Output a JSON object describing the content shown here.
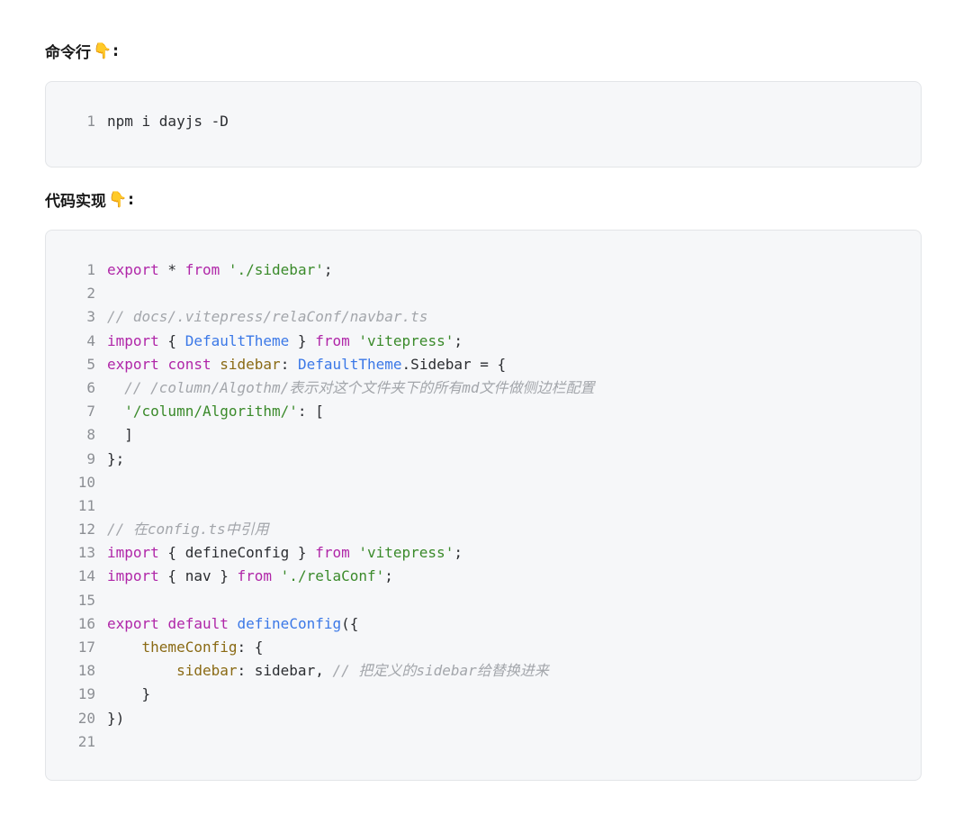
{
  "section1": {
    "title": "命令行",
    "hand_icon": "👇",
    "colon": ":",
    "lines": [
      {
        "n": "1",
        "tokens": [
          {
            "t": "npm i dayjs -D",
            "c": ""
          }
        ]
      }
    ]
  },
  "section2": {
    "title": "代码实现",
    "hand_icon": "👇",
    "colon": ":",
    "lines": [
      {
        "n": "1",
        "tokens": [
          {
            "t": "export",
            "c": "kw"
          },
          {
            "t": " * ",
            "c": ""
          },
          {
            "t": "from",
            "c": "kw"
          },
          {
            "t": " ",
            "c": ""
          },
          {
            "t": "'./sidebar'",
            "c": "str"
          },
          {
            "t": ";",
            "c": ""
          }
        ]
      },
      {
        "n": "2",
        "tokens": []
      },
      {
        "n": "3",
        "tokens": [
          {
            "t": "// docs/.vitepress/relaConf/navbar.ts",
            "c": "cmt"
          }
        ]
      },
      {
        "n": "4",
        "tokens": [
          {
            "t": "import",
            "c": "kw"
          },
          {
            "t": " { ",
            "c": ""
          },
          {
            "t": "DefaultTheme",
            "c": "cls"
          },
          {
            "t": " } ",
            "c": ""
          },
          {
            "t": "from",
            "c": "kw"
          },
          {
            "t": " ",
            "c": ""
          },
          {
            "t": "'vitepress'",
            "c": "str"
          },
          {
            "t": ";",
            "c": ""
          }
        ]
      },
      {
        "n": "5",
        "tokens": [
          {
            "t": "export",
            "c": "kw"
          },
          {
            "t": " ",
            "c": ""
          },
          {
            "t": "const",
            "c": "kw"
          },
          {
            "t": " ",
            "c": ""
          },
          {
            "t": "sidebar",
            "c": "prop"
          },
          {
            "t": ": ",
            "c": ""
          },
          {
            "t": "DefaultTheme",
            "c": "cls"
          },
          {
            "t": ".Sidebar = {",
            "c": ""
          }
        ]
      },
      {
        "n": "6",
        "tokens": [
          {
            "t": "  ",
            "c": ""
          },
          {
            "t": "// /column/Algothm/表示对这个文件夹下的所有md文件做侧边栏配置",
            "c": "cmt"
          }
        ]
      },
      {
        "n": "7",
        "tokens": [
          {
            "t": "  ",
            "c": ""
          },
          {
            "t": "'/column/Algorithm/'",
            "c": "str"
          },
          {
            "t": ": [",
            "c": ""
          }
        ]
      },
      {
        "n": "8",
        "tokens": [
          {
            "t": "  ]",
            "c": ""
          }
        ]
      },
      {
        "n": "9",
        "tokens": [
          {
            "t": "};",
            "c": ""
          }
        ]
      },
      {
        "n": "10",
        "tokens": []
      },
      {
        "n": "11",
        "tokens": []
      },
      {
        "n": "12",
        "tokens": [
          {
            "t": "// 在config.ts中引用",
            "c": "cmt"
          }
        ]
      },
      {
        "n": "13",
        "tokens": [
          {
            "t": "import",
            "c": "kw"
          },
          {
            "t": " { defineConfig } ",
            "c": ""
          },
          {
            "t": "from",
            "c": "kw"
          },
          {
            "t": " ",
            "c": ""
          },
          {
            "t": "'vitepress'",
            "c": "str"
          },
          {
            "t": ";",
            "c": ""
          }
        ]
      },
      {
        "n": "14",
        "tokens": [
          {
            "t": "import",
            "c": "kw"
          },
          {
            "t": " { nav } ",
            "c": ""
          },
          {
            "t": "from",
            "c": "kw"
          },
          {
            "t": " ",
            "c": ""
          },
          {
            "t": "'./relaConf'",
            "c": "str"
          },
          {
            "t": ";",
            "c": ""
          }
        ]
      },
      {
        "n": "15",
        "tokens": []
      },
      {
        "n": "16",
        "tokens": [
          {
            "t": "export",
            "c": "kw"
          },
          {
            "t": " ",
            "c": ""
          },
          {
            "t": "default",
            "c": "kw"
          },
          {
            "t": " ",
            "c": ""
          },
          {
            "t": "defineConfig",
            "c": "cls"
          },
          {
            "t": "({",
            "c": ""
          }
        ]
      },
      {
        "n": "17",
        "tokens": [
          {
            "t": "    ",
            "c": ""
          },
          {
            "t": "themeConfig",
            "c": "prop"
          },
          {
            "t": ": {",
            "c": ""
          }
        ]
      },
      {
        "n": "18",
        "tokens": [
          {
            "t": "        ",
            "c": ""
          },
          {
            "t": "sidebar",
            "c": "prop"
          },
          {
            "t": ": sidebar, ",
            "c": ""
          },
          {
            "t": "// 把定义的sidebar给替换进来",
            "c": "cmt"
          }
        ]
      },
      {
        "n": "19",
        "tokens": [
          {
            "t": "    }",
            "c": ""
          }
        ]
      },
      {
        "n": "20",
        "tokens": [
          {
            "t": "})",
            "c": ""
          }
        ]
      },
      {
        "n": "21",
        "tokens": []
      }
    ]
  },
  "colors": {
    "keyword": "#b026a8",
    "string": "#3a8a2a",
    "type": "#3b78e7",
    "property": "#8a6a14",
    "comment": "#a3a6ab",
    "block_background": "#f6f7f9"
  }
}
